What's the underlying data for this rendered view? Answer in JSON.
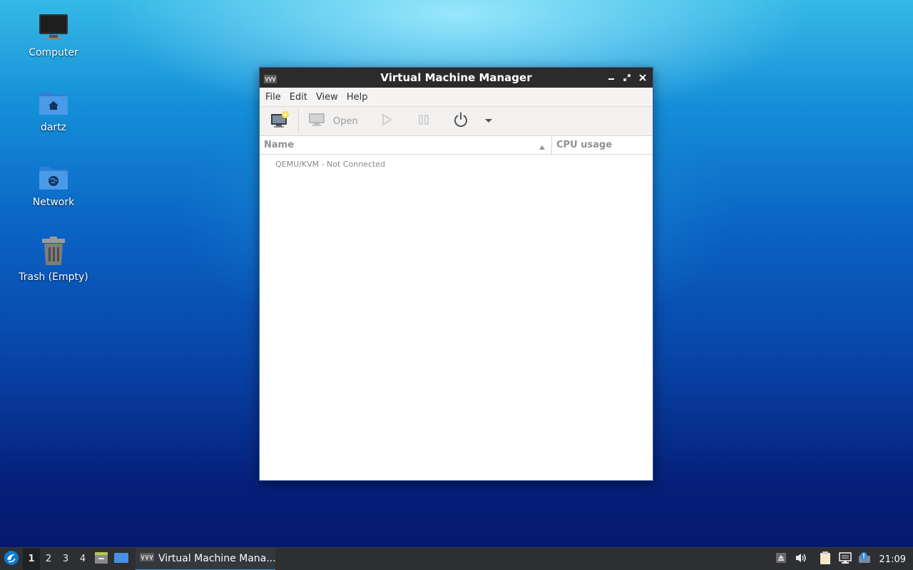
{
  "desktop": {
    "icons": [
      {
        "label": "Computer"
      },
      {
        "label": "dartz"
      },
      {
        "label": "Network"
      },
      {
        "label": "Trash (Empty)"
      }
    ]
  },
  "window": {
    "title": "Virtual Machine Manager",
    "menu": [
      "File",
      "Edit",
      "View",
      "Help"
    ],
    "toolbar": {
      "open_label": "Open"
    },
    "columns": {
      "name": "Name",
      "cpu": "CPU usage"
    },
    "rows": [
      {
        "label": "QEMU/KVM - Not Connected"
      }
    ]
  },
  "taskbar": {
    "workspaces": [
      "1",
      "2",
      "3",
      "4"
    ],
    "task_label": "Virtual Machine Mana...",
    "clock": "21:09"
  },
  "colors": {
    "titlebar": "#2b2b2b",
    "taskbar": "#2d2f33",
    "accent": "#3a8ee6"
  }
}
